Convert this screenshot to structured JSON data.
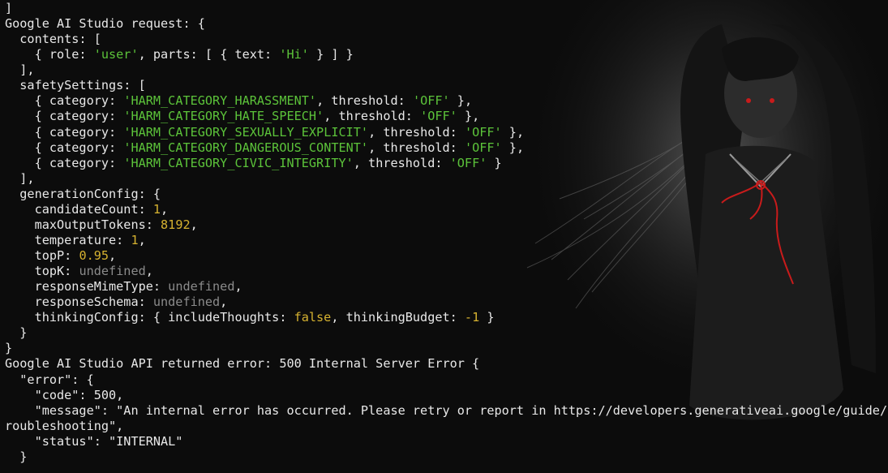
{
  "terminal": {
    "lines": [
      [
        {
          "t": "]",
          "c": "p"
        }
      ],
      [
        {
          "t": "Google AI Studio request: {",
          "c": "p"
        }
      ],
      [
        {
          "t": "  contents: [",
          "c": "p"
        }
      ],
      [
        {
          "t": "    { role: ",
          "c": "p"
        },
        {
          "t": "'user'",
          "c": "s"
        },
        {
          "t": ", parts: [ { text: ",
          "c": "p"
        },
        {
          "t": "'Hi'",
          "c": "s"
        },
        {
          "t": " } ] }",
          "c": "p"
        }
      ],
      [
        {
          "t": "  ],",
          "c": "p"
        }
      ],
      [
        {
          "t": "  safetySettings: [",
          "c": "p"
        }
      ],
      [
        {
          "t": "    { category: ",
          "c": "p"
        },
        {
          "t": "'HARM_CATEGORY_HARASSMENT'",
          "c": "s"
        },
        {
          "t": ", threshold: ",
          "c": "p"
        },
        {
          "t": "'OFF'",
          "c": "s"
        },
        {
          "t": " },",
          "c": "p"
        }
      ],
      [
        {
          "t": "    { category: ",
          "c": "p"
        },
        {
          "t": "'HARM_CATEGORY_HATE_SPEECH'",
          "c": "s"
        },
        {
          "t": ", threshold: ",
          "c": "p"
        },
        {
          "t": "'OFF'",
          "c": "s"
        },
        {
          "t": " },",
          "c": "p"
        }
      ],
      [
        {
          "t": "    { category: ",
          "c": "p"
        },
        {
          "t": "'HARM_CATEGORY_SEXUALLY_EXPLICIT'",
          "c": "s"
        },
        {
          "t": ", threshold: ",
          "c": "p"
        },
        {
          "t": "'OFF'",
          "c": "s"
        },
        {
          "t": " },",
          "c": "p"
        }
      ],
      [
        {
          "t": "    { category: ",
          "c": "p"
        },
        {
          "t": "'HARM_CATEGORY_DANGEROUS_CONTENT'",
          "c": "s"
        },
        {
          "t": ", threshold: ",
          "c": "p"
        },
        {
          "t": "'OFF'",
          "c": "s"
        },
        {
          "t": " },",
          "c": "p"
        }
      ],
      [
        {
          "t": "    { category: ",
          "c": "p"
        },
        {
          "t": "'HARM_CATEGORY_CIVIC_INTEGRITY'",
          "c": "s"
        },
        {
          "t": ", threshold: ",
          "c": "p"
        },
        {
          "t": "'OFF'",
          "c": "s"
        },
        {
          "t": " }",
          "c": "p"
        }
      ],
      [
        {
          "t": "  ],",
          "c": "p"
        }
      ],
      [
        {
          "t": "  generationConfig: {",
          "c": "p"
        }
      ],
      [
        {
          "t": "    candidateCount: ",
          "c": "p"
        },
        {
          "t": "1",
          "c": "n"
        },
        {
          "t": ",",
          "c": "p"
        }
      ],
      [
        {
          "t": "    maxOutputTokens: ",
          "c": "p"
        },
        {
          "t": "8192",
          "c": "n"
        },
        {
          "t": ",",
          "c": "p"
        }
      ],
      [
        {
          "t": "    temperature: ",
          "c": "p"
        },
        {
          "t": "1",
          "c": "n"
        },
        {
          "t": ",",
          "c": "p"
        }
      ],
      [
        {
          "t": "    topP: ",
          "c": "p"
        },
        {
          "t": "0.95",
          "c": "n"
        },
        {
          "t": ",",
          "c": "p"
        }
      ],
      [
        {
          "t": "    topK: ",
          "c": "p"
        },
        {
          "t": "undefined",
          "c": "u"
        },
        {
          "t": ",",
          "c": "p"
        }
      ],
      [
        {
          "t": "    responseMimeType: ",
          "c": "p"
        },
        {
          "t": "undefined",
          "c": "u"
        },
        {
          "t": ",",
          "c": "p"
        }
      ],
      [
        {
          "t": "    responseSchema: ",
          "c": "p"
        },
        {
          "t": "undefined",
          "c": "u"
        },
        {
          "t": ",",
          "c": "p"
        }
      ],
      [
        {
          "t": "    thinkingConfig: { includeThoughts: ",
          "c": "p"
        },
        {
          "t": "false",
          "c": "b"
        },
        {
          "t": ", thinkingBudget: ",
          "c": "p"
        },
        {
          "t": "-1",
          "c": "n"
        },
        {
          "t": " }",
          "c": "p"
        }
      ],
      [
        {
          "t": "  }",
          "c": "p"
        }
      ],
      [
        {
          "t": "}",
          "c": "p"
        }
      ],
      [
        {
          "t": "Google AI Studio API returned error: 500 Internal Server Error {",
          "c": "p"
        }
      ],
      [
        {
          "t": "  \"error\": {",
          "c": "p"
        }
      ],
      [
        {
          "t": "    \"code\": 500,",
          "c": "p"
        }
      ],
      [
        {
          "t": "    \"message\": \"An internal error has occurred. Please retry or report in https://developers.generativeai.google/guide/t",
          "c": "p"
        }
      ],
      [
        {
          "t": "roubleshooting\",",
          "c": "p"
        }
      ],
      [
        {
          "t": "    \"status\": \"INTERNAL\"",
          "c": "p"
        }
      ],
      [
        {
          "t": "  }",
          "c": "p"
        }
      ]
    ]
  },
  "background_art": {
    "icon": "anime-girl-wallpaper",
    "accent_color": "#c81b1b"
  }
}
